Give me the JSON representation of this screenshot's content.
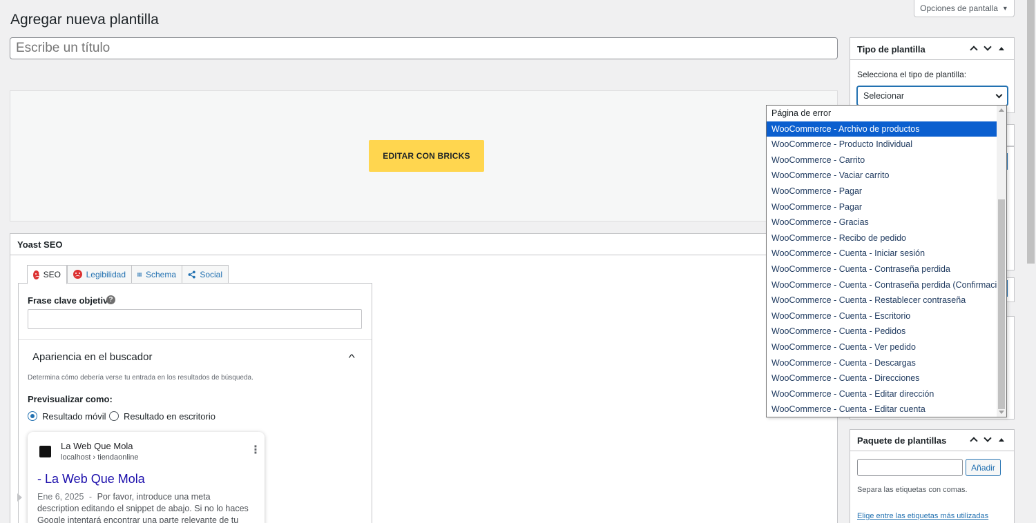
{
  "screen_options": {
    "label": "Opciones de pantalla"
  },
  "page": {
    "title": "Agregar nueva plantilla"
  },
  "title_input": {
    "placeholder": "Escribe un título"
  },
  "bricks": {
    "button_label": "EDITAR CON BRICKS",
    "color": "#ffd64f"
  },
  "yoast": {
    "header": "Yoast SEO",
    "tabs": [
      {
        "label": "SEO",
        "icon": "sad-face-icon",
        "active": true
      },
      {
        "label": "Legibilidad",
        "icon": "sad-face-icon"
      },
      {
        "label": "Schema",
        "icon": "grid-icon"
      },
      {
        "label": "Social",
        "icon": "share-icon"
      }
    ],
    "keyphrase_label": "Frase clave objetivo",
    "keyphrase_value": "",
    "appearance_title": "Apariencia en el buscador",
    "appearance_desc": "Determina cómo debería verse tu entrada en los resultados de búsqueda.",
    "preview_label": "Previsualizar como:",
    "preview_options": [
      {
        "label": "Resultado móvil",
        "checked": true
      },
      {
        "label": "Resultado en escritorio",
        "checked": false
      }
    ],
    "snippet": {
      "site_name": "La Web Que Mola",
      "url": "localhost › tiendaonline",
      "title": "- La Web Que Mola",
      "date": "Ene 6, 2025",
      "separator": "-",
      "description": "Por favor, introduce una meta description editando el snippet de abajo. Si no lo haces Google intentará encontrar una parte relevante de tu contenido"
    }
  },
  "template_type": {
    "title": "Tipo de plantilla",
    "prompt": "Selecciona el tipo de plantilla:",
    "select_value": "Selecionar",
    "options": [
      "Página de error",
      "WooCommerce - Archivo de productos",
      "WooCommerce - Producto Individual",
      "WooCommerce - Carrito",
      "WooCommerce - Vaciar carrito",
      "WooCommerce - Pagar",
      "WooCommerce - Pagar",
      "WooCommerce - Gracias",
      "WooCommerce - Recibo de pedido",
      "WooCommerce - Cuenta - Iniciar sesión",
      "WooCommerce - Cuenta - Contraseña perdida",
      "WooCommerce - Cuenta - Contraseña perdida (Confirmación)",
      "WooCommerce - Cuenta - Restablecer contraseña",
      "WooCommerce - Cuenta - Escritorio",
      "WooCommerce - Cuenta - Pedidos",
      "WooCommerce - Cuenta - Ver pedido",
      "WooCommerce - Cuenta - Descargas",
      "WooCommerce - Cuenta - Direcciones",
      "WooCommerce - Cuenta - Editar dirección",
      "WooCommerce - Cuenta - Editar cuenta"
    ],
    "selected_index": 1
  },
  "template_tags": {
    "title": "Paquete de plantillas",
    "add_label": "Añadir",
    "hint": "Separa las etiquetas con comas.",
    "link": "Elige entre las etiquetas más utilizadas"
  }
}
